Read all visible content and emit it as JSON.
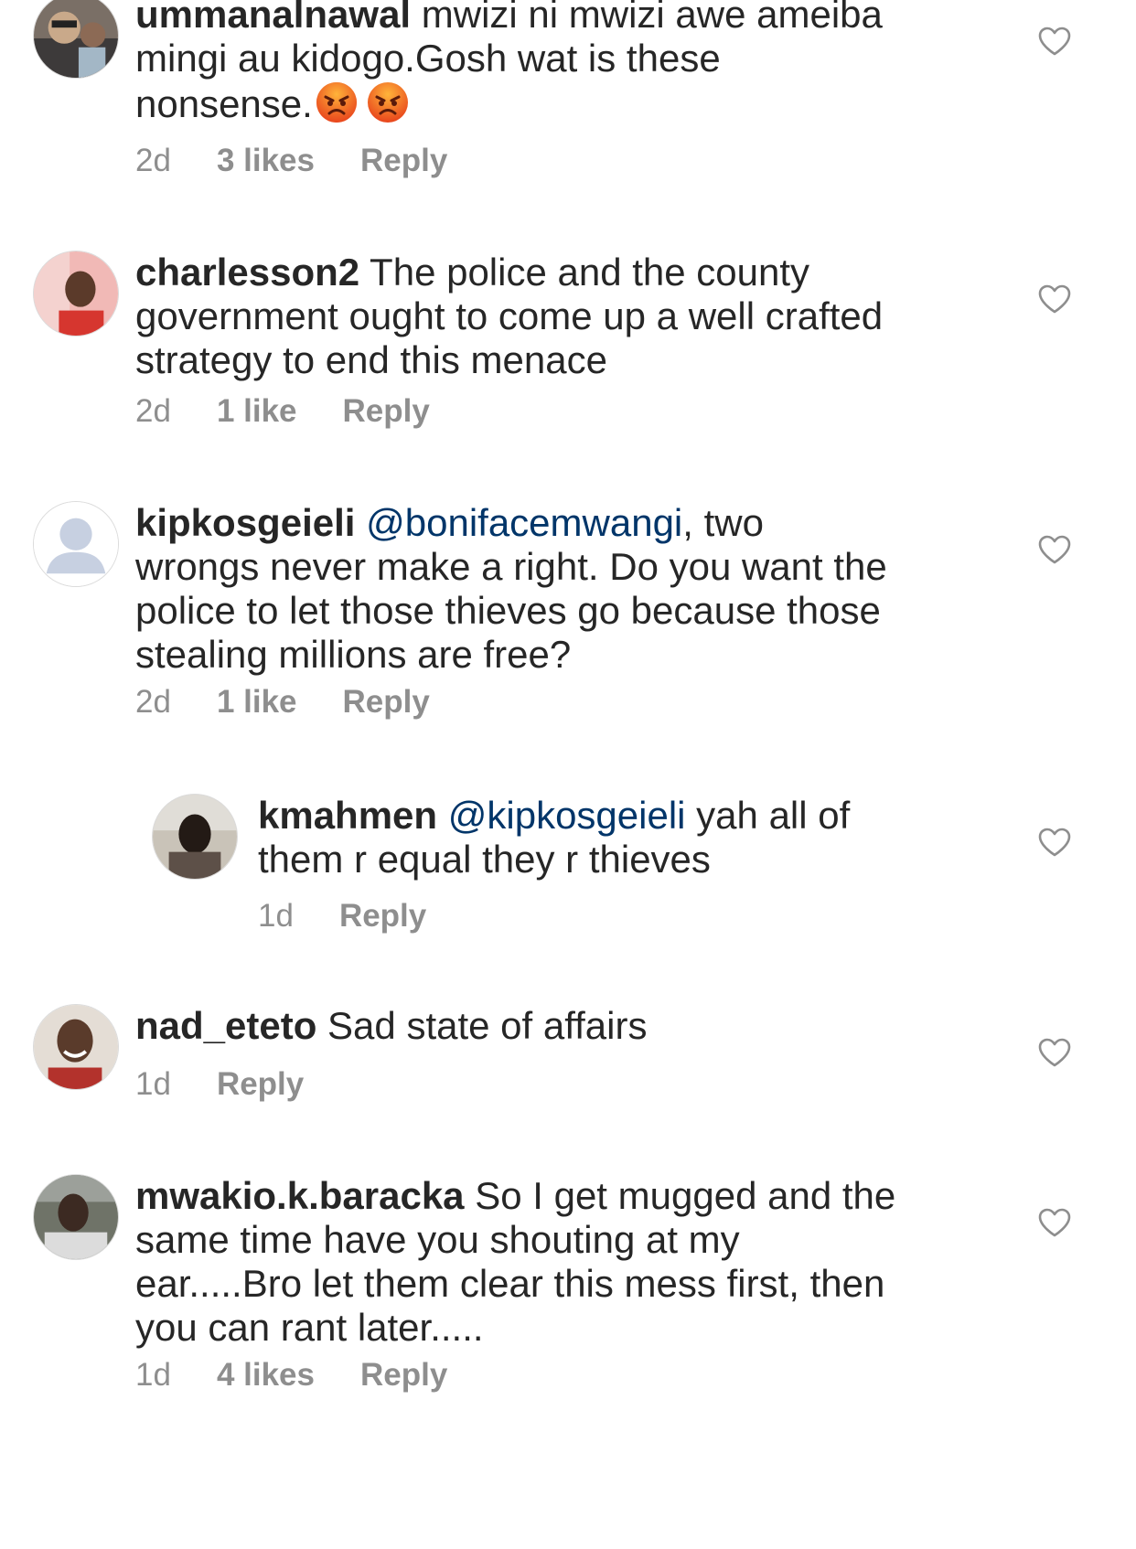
{
  "comments": [
    {
      "username": "ummanalnawal",
      "text_1": " mwizi ni mwizi awe ameiba mingi au kidogo.Gosh wat is these nonsense.",
      "emoji_name": "angry-face-icon",
      "time": "2d",
      "likes": "3 likes",
      "reply": "Reply"
    },
    {
      "username": "charlesson2",
      "text_1": " The police and the county government ought to come up a well crafted strategy to end this menace",
      "time": "2d",
      "likes": "1 like",
      "reply": "Reply"
    },
    {
      "username": "kipkosgeieli",
      "mention": "@bonifacemwangi",
      "text_1": ", two wrongs never make a right. Do you want the police to let those thieves go because those stealing millions are free?",
      "time": "2d",
      "likes": "1 like",
      "reply": "Reply"
    },
    {
      "username": "kmahmen",
      "mention": "@kipkosgeieli",
      "text_1": " yah all of them r equal they r thieves",
      "time": "1d",
      "reply": "Reply"
    },
    {
      "username": "nad_eteto",
      "text_1": " Sad state of affairs",
      "time": "1d",
      "reply": "Reply"
    },
    {
      "username": "mwakio.k.baracka",
      "text_1": " So I get mugged and the same time have you shouting at my ear.....Bro let them clear this mess first, then you can rant later.....",
      "time": "1d",
      "likes": "4 likes",
      "reply": "Reply"
    }
  ],
  "colors": {
    "text": "#262626",
    "meta": "#8e8e8e",
    "mention": "#003569",
    "heart": "#8e8e8e"
  }
}
